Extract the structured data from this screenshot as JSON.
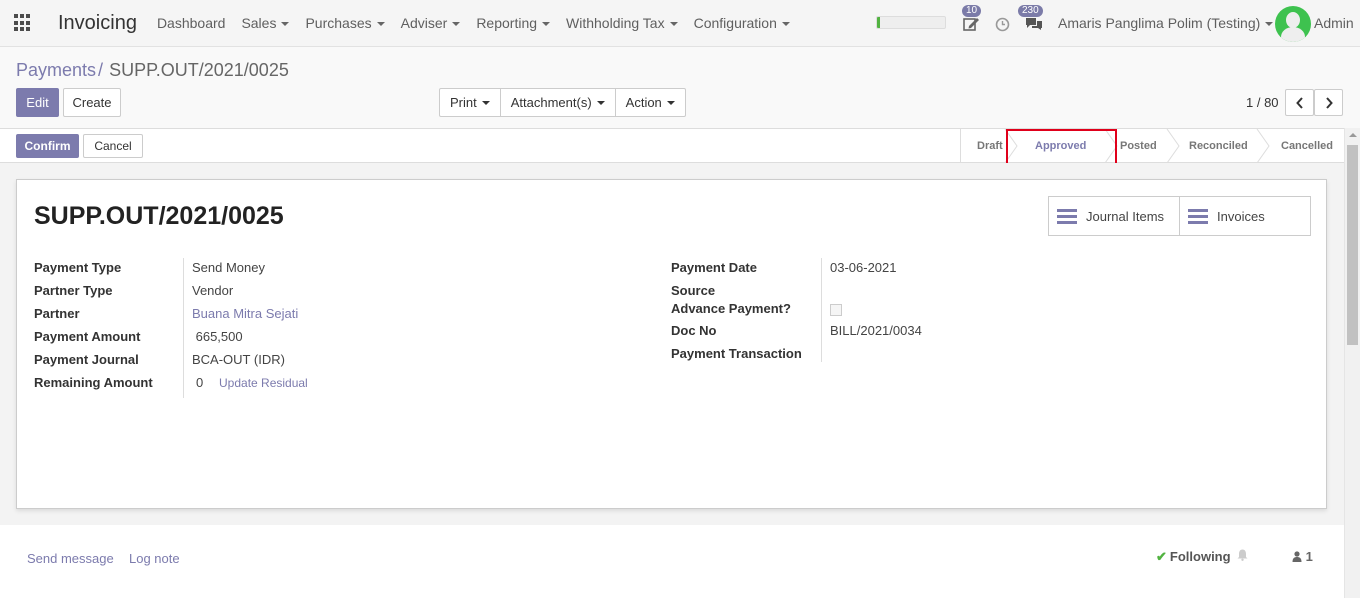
{
  "navbar": {
    "app_name": "Invoicing",
    "menus": [
      "Dashboard",
      "Sales",
      "Purchases",
      "Adviser",
      "Reporting",
      "Withholding Tax",
      "Configuration"
    ],
    "activity_badge": "10",
    "messages_badge": "230",
    "user_name": "Amaris Panglima Polim (Testing)",
    "admin_label": "Admin",
    "progress_fraction": 0.05
  },
  "breadcrumb": {
    "parent": "Payments",
    "separator": "/",
    "current": "SUPP.OUT/2021/0025"
  },
  "toolbar": {
    "edit": "Edit",
    "create": "Create",
    "print": "Print",
    "attachments": "Attachment(s)",
    "action": "Action",
    "pager": "1 / 80"
  },
  "status_actions": {
    "confirm": "Confirm",
    "cancel": "Cancel"
  },
  "stages": [
    "Draft",
    "Approved",
    "Posted",
    "Reconciled",
    "Cancelled"
  ],
  "active_stage": "Approved",
  "record": {
    "title": "SUPP.OUT/2021/0025",
    "smart_buttons": [
      "Journal Items",
      "Invoices"
    ],
    "left_fields": [
      {
        "label": "Payment Type",
        "value": "Send Money"
      },
      {
        "label": "Partner Type",
        "value": "Vendor"
      },
      {
        "label": "Partner",
        "value": "Buana Mitra Sejati"
      },
      {
        "label": "Payment Amount",
        "value": " 665,500"
      },
      {
        "label": "Payment Journal",
        "value": "BCA-OUT (IDR)"
      },
      {
        "label": "Remaining Amount",
        "value": "0"
      }
    ],
    "update_residual": "Update Residual",
    "right_fields": [
      {
        "label": "Payment Date",
        "value": "03-06-2021"
      },
      {
        "label": "Source",
        "value": ""
      },
      {
        "label": "Advance Payment?",
        "value": ""
      },
      {
        "label": "Doc No",
        "value": "BILL/2021/0034"
      },
      {
        "label": "Payment Transaction",
        "value": ""
      }
    ]
  },
  "chatter": {
    "send_message": "Send message",
    "log_note": "Log note",
    "following": "Following",
    "followers_count": "1"
  }
}
